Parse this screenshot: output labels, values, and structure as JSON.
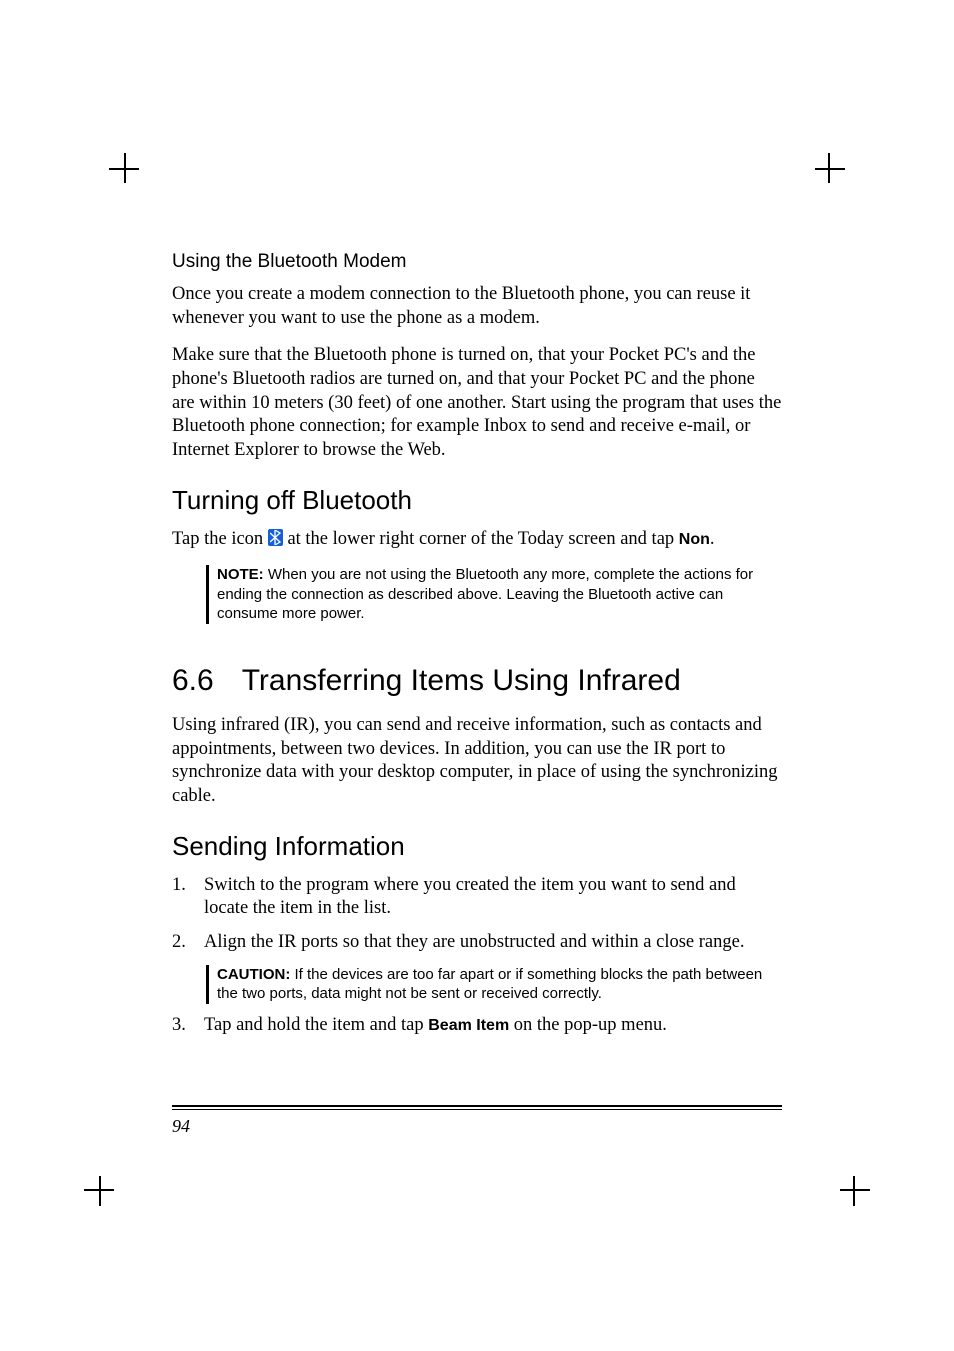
{
  "subheading_modem": "Using the Bluetooth Modem",
  "para_modem_1": "Once you create a modem connection to the Bluetooth phone, you can reuse it whenever you want to use the phone as a modem.",
  "para_modem_2": "Make sure that the Bluetooth phone is turned on, that your Pocket PC's and the phone's Bluetooth radios are turned on, and that your Pocket PC and the phone are within 10 meters (30 feet) of one another. Start using the program that uses the Bluetooth phone connection; for example Inbox to send and receive e-mail, or Internet Explorer to browse the Web.",
  "h2_turnoff": "Turning off Bluetooth",
  "para_turnoff_pre": "Tap the icon ",
  "para_turnoff_mid": " at the lower right corner of the Today screen and tap ",
  "ui_non": "Non",
  "para_turnoff_end": ".",
  "note1_label": "NOTE:",
  "note1_body": " When you are not using the Bluetooth any more, complete the actions for ending the connection as described above. Leaving the Bluetooth active can consume more power.",
  "h1_num": "6.6",
  "h1_title": "Transferring Items Using Infrared",
  "para_ir": "Using infrared (IR), you can send and receive information, such as contacts and appointments, between two devices. In addition, you can use the IR port to synchronize data with your desktop computer, in place of using the synchronizing cable.",
  "h2_sending": "Sending Information",
  "step1": "Switch to the program where you created the item you want to send and locate the item in the list.",
  "step2": "Align the IR ports so that they are unobstructed and within a close range.",
  "caution_label": "CAUTION:",
  "caution_body": " If the devices are too far apart or if something blocks the path between the two ports, data might not be sent or received correctly.",
  "step3_pre": "Tap and hold the item and tap ",
  "ui_beam": "Beam Item",
  "step3_post": " on the pop-up menu.",
  "page_number": "94"
}
